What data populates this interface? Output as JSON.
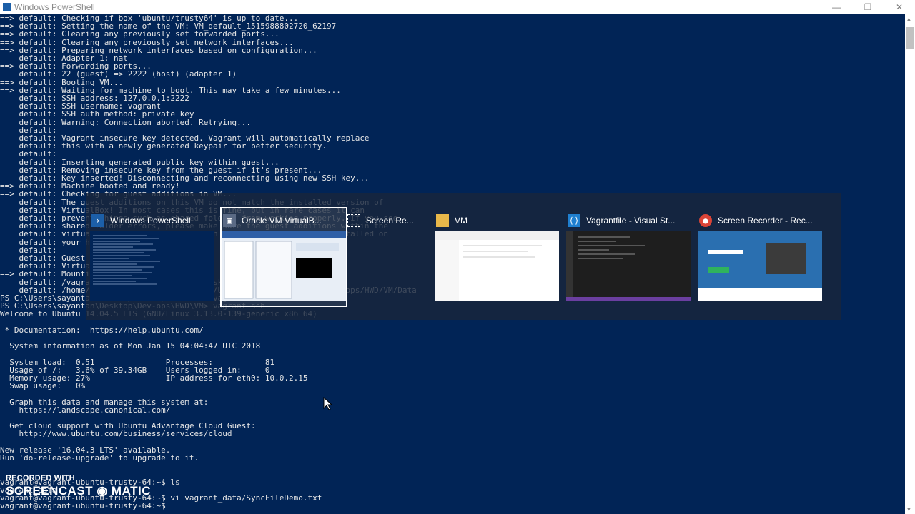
{
  "window": {
    "title": "Windows PowerShell",
    "minimize": "—",
    "maximize": "❐",
    "close": "✕"
  },
  "terminal": {
    "lines": [
      "==> default: Checking if box 'ubuntu/trusty64' is up to date...",
      "==> default: Setting the name of the VM: VM_default_1515988802720_62197",
      "==> default: Clearing any previously set forwarded ports...",
      "==> default: Clearing any previously set network interfaces...",
      "==> default: Preparing network interfaces based on configuration...",
      "    default: Adapter 1: nat",
      "==> default: Forwarding ports...",
      "    default: 22 (guest) => 2222 (host) (adapter 1)",
      "==> default: Booting VM...",
      "==> default: Waiting for machine to boot. This may take a few minutes...",
      "    default: SSH address: 127.0.0.1:2222",
      "    default: SSH username: vagrant",
      "    default: SSH auth method: private key",
      "    default: Warning: Connection aborted. Retrying...",
      "    default:",
      "    default: Vagrant insecure key detected. Vagrant will automatically replace",
      "    default: this with a newly generated keypair for better security.",
      "    default:",
      "    default: Inserting generated public key within guest...",
      "    default: Removing insecure key from the guest if it's present...",
      "    default: Key inserted! Disconnecting and reconnecting using new SSH key...",
      "==> default: Machine booted and ready!",
      "==> default: Checking for guest additions in VM...",
      "    default: The guest additions on this VM do not match the installed version of",
      "    default: VirtualBox! In most cases this is fine, but in rare cases it can",
      "    default: prevent things such as shared folders from working properly. If you see",
      "    default: shared folder errors, please make sure the guest additions within the",
      "    default: virtual machine match the version of VirtualBox you have installed on",
      "    default: your host and reload your VM.",
      "    default:",
      "    default: Guest Additions Version: 4.3.36",
      "    default: VirtualBox Version: 5.2",
      "==> default: Mounting shared folders...",
      "    default: /vagrant => C:/Users/sayantan/Desktop",
      "    default: /home/vagrant/vagrant_data => C:/Users/sayantan/Desktop/Dev-ops/HWD/VM/Data",
      "PS C:\\Users\\sayantan\\Desktop\\Dev-ops\\HWD\\VM> vagrant ssh",
      "PS C:\\Users\\sayantan\\Desktop\\Dev-ops\\HWD\\VM> vagrant ssh",
      "Welcome to Ubuntu 14.04.5 LTS (GNU/Linux 3.13.0-139-generic x86_64)",
      "",
      " * Documentation:  https://help.ubuntu.com/",
      "",
      "  System information as of Mon Jan 15 04:04:47 UTC 2018",
      "",
      "  System load:  0.51               Processes:           81",
      "  Usage of /:   3.6% of 39.34GB    Users logged in:     0",
      "  Memory usage: 27%                IP address for eth0: 10.0.2.15",
      "  Swap usage:   0%",
      "",
      "  Graph this data and manage this system at:",
      "    https://landscape.canonical.com/",
      "",
      "  Get cloud support with Ubuntu Advantage Cloud Guest:",
      "    http://www.ubuntu.com/business/services/cloud",
      "",
      "New release '16.04.3 LTS' available.",
      "Run 'do-release-upgrade' to upgrade to it.",
      "",
      "",
      "vagrant@vagrant-ubuntu-trusty-64:~$ ls",
      "vagrant_data",
      "vagrant@vagrant-ubuntu-trusty-64:~$ vi vagrant_data/SyncFileDemo.txt",
      "vagrant@vagrant-ubuntu-trusty-64:~$"
    ]
  },
  "task_switcher": {
    "items": [
      {
        "label": "Windows PowerShell",
        "icon": "powershell-icon",
        "selected": false
      },
      {
        "label": "Oracle VM VirtualB...",
        "icon": "virtualbox-icon",
        "selected": true
      },
      {
        "label": "Screen Re...",
        "icon": "screen-recorder-icon",
        "selected": false
      },
      {
        "label": "VM",
        "icon": "folder-icon",
        "selected": false
      },
      {
        "label": "Vagrantfile - Visual St...",
        "icon": "vscode-icon",
        "selected": false
      },
      {
        "label": "Screen Recorder - Rec...",
        "icon": "chrome-icon",
        "selected": false
      }
    ]
  },
  "watermark": {
    "line1": "RECORDED WITH",
    "line2": "SCREENCAST ◉ MATIC"
  },
  "colors": {
    "terminal_bg": "#012456",
    "terminal_fg": "#e6e6e6",
    "switcher_bg": "#19263c"
  }
}
